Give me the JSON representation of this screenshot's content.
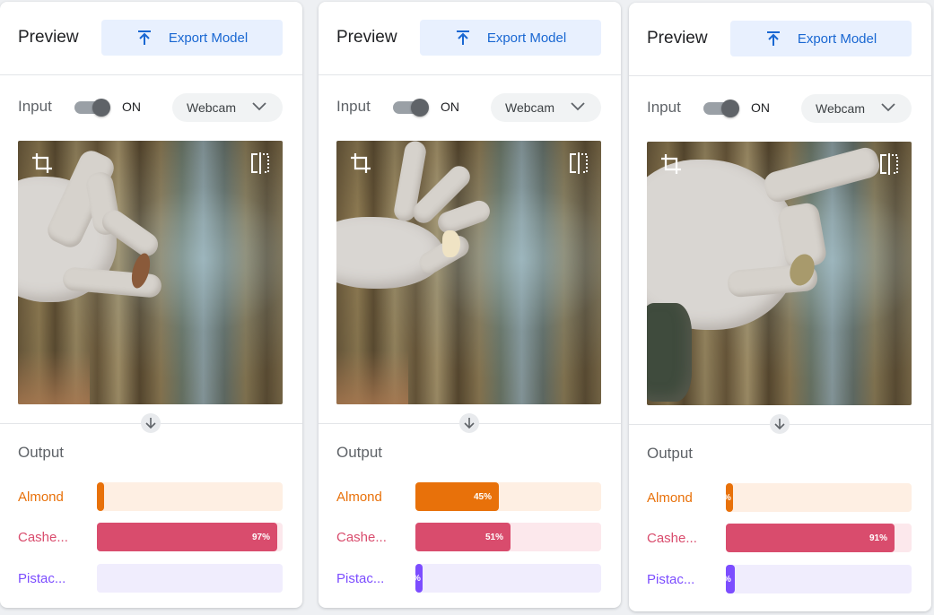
{
  "panels": [
    {
      "preview_title": "Preview",
      "export_label": "Export Model",
      "input_label": "Input",
      "toggle_state": "ON",
      "source": "Webcam",
      "output_title": "Output",
      "classes": [
        {
          "label": "Almond",
          "percent": 3,
          "percent_text": ""
        },
        {
          "label": "Cashe...",
          "percent": 97,
          "percent_text": "97%"
        },
        {
          "label": "Pistac...",
          "percent": 0,
          "percent_text": ""
        }
      ]
    },
    {
      "preview_title": "Preview",
      "export_label": "Export Model",
      "input_label": "Input",
      "toggle_state": "ON",
      "source": "Webcam",
      "output_title": "Output",
      "classes": [
        {
          "label": "Almond",
          "percent": 45,
          "percent_text": "45%"
        },
        {
          "label": "Cashe...",
          "percent": 51,
          "percent_text": "51%"
        },
        {
          "label": "Pistac...",
          "percent": 4,
          "percent_text": "%"
        }
      ]
    },
    {
      "preview_title": "Preview",
      "export_label": "Export Model",
      "input_label": "Input",
      "toggle_state": "ON",
      "source": "Webcam",
      "output_title": "Output",
      "classes": [
        {
          "label": "Almond",
          "percent": 4,
          "percent_text": "%"
        },
        {
          "label": "Cashe...",
          "percent": 91,
          "percent_text": "91%"
        },
        {
          "label": "Pistac...",
          "percent": 5,
          "percent_text": "%"
        }
      ]
    }
  ],
  "colors": {
    "accent_blue": "#1967d2",
    "almond": "#e8710a",
    "almond_bg": "#feefe3",
    "cashew": "#d94c6d",
    "cashew_bg": "#fce8ec",
    "pistachio": "#7c4dff",
    "pistachio_bg": "#f0edfd"
  },
  "icons": {
    "export": "upload-arrow-icon",
    "crop": "crop-icon",
    "flip": "flip-horizontal-icon",
    "dropdown": "chevron-down-icon",
    "output_arrow": "arrow-down-icon"
  }
}
